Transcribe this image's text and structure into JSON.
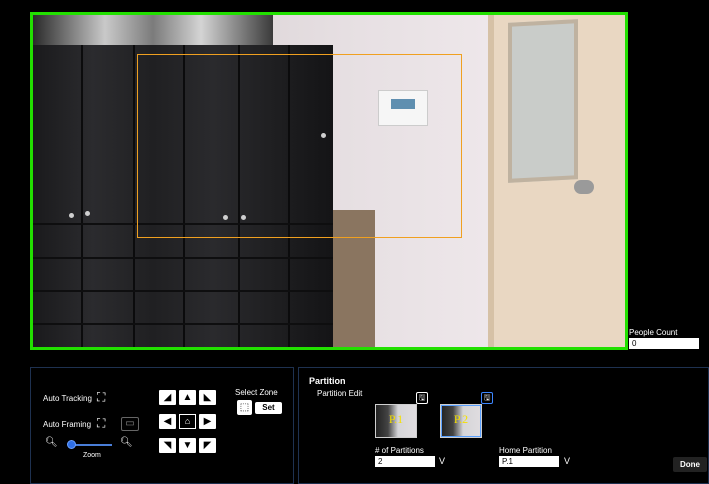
{
  "video": {
    "tracking_box_color": "#f0a020",
    "frame_color": "#22e000"
  },
  "people_count": {
    "label": "People Count",
    "value": "0"
  },
  "ptz": {
    "auto_tracking_label": "Auto Tracking",
    "auto_framing_label": "Auto Framing",
    "zoom_label": "Zoom",
    "zoom_level": 0.05,
    "select_zone_label": "Select Zone",
    "set_label": "Set",
    "icons": {
      "tracking": "⛶",
      "framing": "⛶",
      "framing_mode": "▭",
      "zoom_out": "🔍︎",
      "zoom_in": "🔍︎",
      "home": "⌂",
      "select_zone": "⬚"
    },
    "arrows": {
      "up_left": "◢",
      "up": "▲",
      "up_right": "◣",
      "left": "◀",
      "right": "▶",
      "down_left": "◥",
      "down": "▼",
      "down_right": "◤"
    }
  },
  "partition": {
    "title": "Partition",
    "edit_label": "Partition Edit",
    "thumbnails": [
      "P.1",
      "P.2"
    ],
    "count_label": "# of Partitions",
    "count_value": "2",
    "home_label": "Home Partition",
    "home_value": "P.1",
    "done_label": "Done",
    "save_icon": "🖫"
  }
}
